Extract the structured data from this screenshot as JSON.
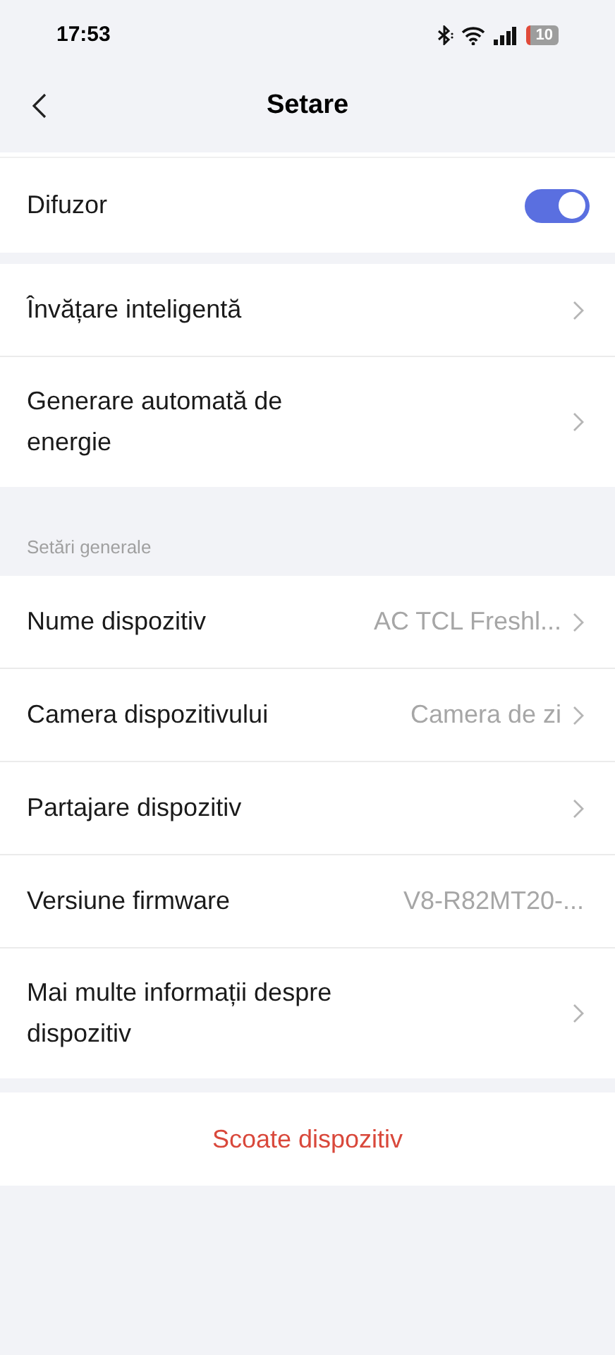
{
  "status_bar": {
    "time": "17:53",
    "battery": "10"
  },
  "header": {
    "title": "Setare"
  },
  "groups": [
    {
      "items": [
        {
          "kind": "toggle",
          "label": "Difuzor",
          "on": true
        }
      ]
    },
    {
      "items": [
        {
          "kind": "link",
          "label": "Învățare inteligentă"
        },
        {
          "kind": "link",
          "label": "Generare automată de energie"
        }
      ]
    },
    {
      "title": "Setări generale",
      "items": [
        {
          "kind": "link",
          "label": "Nume dispozitiv",
          "value": "AC TCL Freshl..."
        },
        {
          "kind": "link",
          "label": "Camera dispozitivului",
          "value": "Camera de zi"
        },
        {
          "kind": "link",
          "label": "Partajare dispozitiv"
        },
        {
          "kind": "info",
          "label": "Versiune firmware",
          "value": "V8-R82MT20-..."
        },
        {
          "kind": "link",
          "label": "Mai multe informații despre dispozitiv"
        }
      ]
    }
  ],
  "remove_button": "Scoate dispozitiv"
}
